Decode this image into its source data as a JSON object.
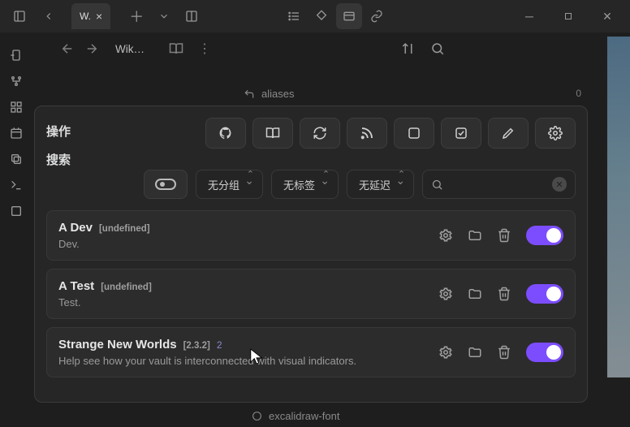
{
  "titlebar": {
    "tab_label": "W.",
    "close_glyph": "×"
  },
  "nav": {
    "crumb": "Wik…"
  },
  "meta": {
    "aliases_label": "aliases",
    "aliases_count": "0",
    "bottom_tag": "excalidraw-font"
  },
  "modal": {
    "section_action": "操作",
    "section_search": "搜索",
    "filters": {
      "group": "无分组",
      "tag": "无标签",
      "delay": "无延迟"
    },
    "items": [
      {
        "title": "A Dev",
        "tag": "[undefined]",
        "version": "",
        "desc": "Dev."
      },
      {
        "title": "A Test",
        "tag": "[undefined]",
        "version": "",
        "desc": "Test."
      },
      {
        "title": "Strange New Worlds",
        "tag": "[2.3.2]",
        "version": "2",
        "desc": "Help see how your vault is interconnected with visual indicators."
      }
    ]
  }
}
